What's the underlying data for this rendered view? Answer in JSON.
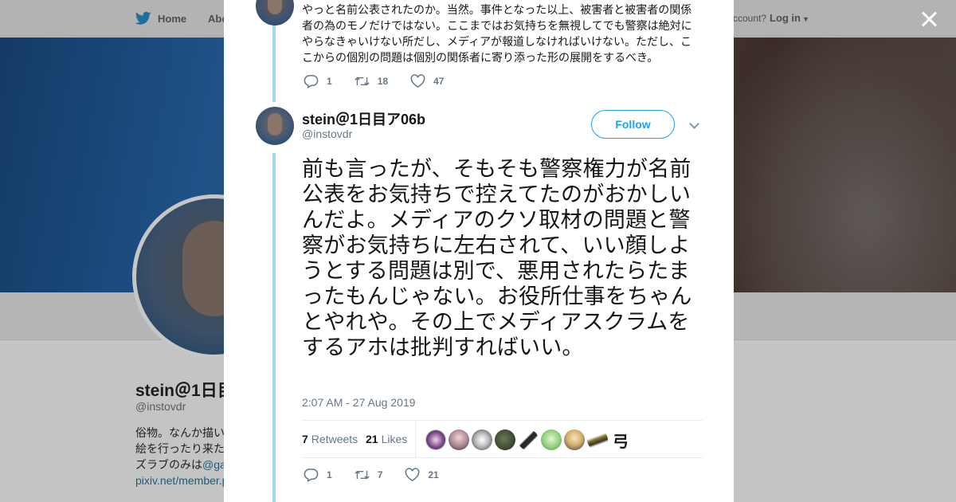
{
  "topnav": {
    "home_label": "Home",
    "about_label": "Abo",
    "account_prompt": "ccount?",
    "login_label": "Log in"
  },
  "profile": {
    "name": "stein＠1日目",
    "handle": "@instovdr",
    "bio_line1": "俗物。なんか描い",
    "bio_line2": "絵を行ったり来た",
    "bio_line3_prefix": "ズラブのみは",
    "bio_line3_link": "@ga",
    "bio_line4_link": "pixiv.net/member.p"
  },
  "previous_tweet": {
    "text": "やっと名前公表されたのか。当然。事件となった以上、被害者と被害者の関係者の為のモノだけではない。ここまではお気持ちを無視してでも警察は絶対にやらなきゃいけない所だし、メディアが報道しなければいけない。ただし、ここからの個別の問題は個別の関係者に寄り添った形の展開をするべき。",
    "replies": "1",
    "retweets": "18",
    "likes": "47"
  },
  "tweet": {
    "author_name": "stein＠1日目ア06b",
    "author_handle": "@instovdr",
    "follow_label": "Follow",
    "text": "前も言ったが、そもそも警察権力が名前公表をお気持ちで控えてたのがおかしいんだよ。メディアのクソ取材の問題と警察がお気持ちに左右されて、いい顔しようとする問題は別で、悪用されたらたまったもんじゃない。お役所仕事をちゃんとやれや。その上でメディアスクラムをするアホは批判すればいい。",
    "timestamp": "2:07 AM - 27 Aug 2019",
    "retweet_count": "7",
    "retweet_label": "Retweets",
    "like_count": "21",
    "like_label": "Likes",
    "likers_last_glyph": "弓",
    "replies": "1",
    "retweets": "7",
    "likes": "21"
  },
  "colors": {
    "twitter_blue": "#1da1f2",
    "thread_line": "#a4d8e4",
    "muted_text": "#657786"
  },
  "icons": [
    "twitter-bird-icon",
    "reply-icon",
    "retweet-icon",
    "heart-icon",
    "close-icon",
    "chevron-down-icon"
  ]
}
